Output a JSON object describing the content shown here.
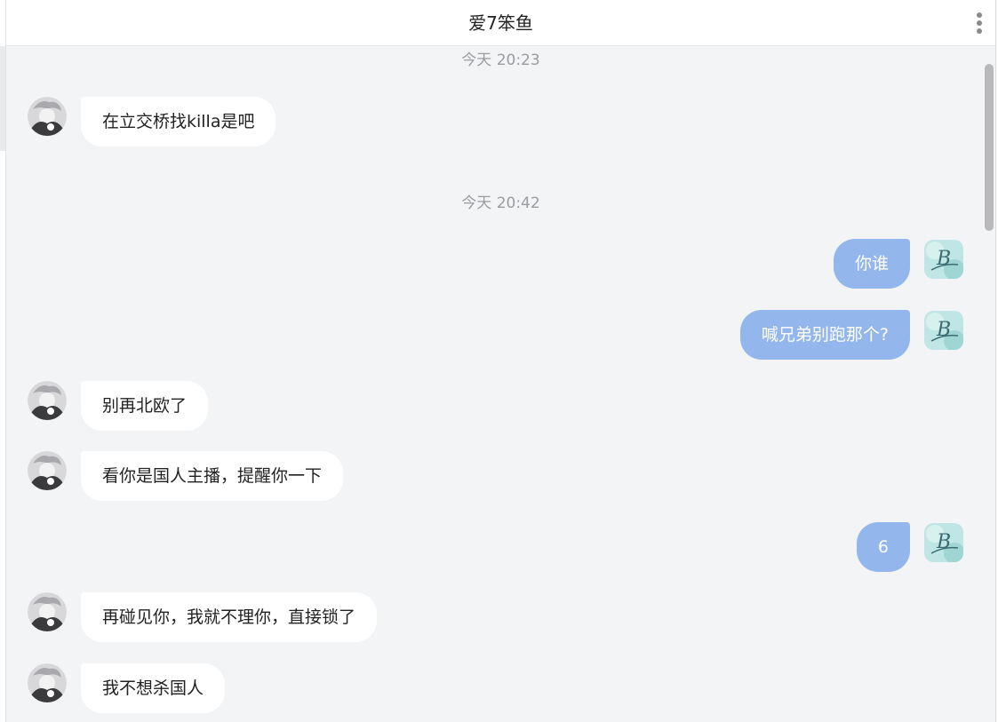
{
  "header": {
    "title": "爱7笨鱼"
  },
  "colors": {
    "outgoing_bubble": "#93b6ec",
    "incoming_bubble": "#ffffff",
    "background": "#f3f4f6"
  },
  "messages": {
    "ts1": "今天 20:23",
    "m1": "在立交桥找killa是吧",
    "ts2": "今天 20:42",
    "m2": "你谁",
    "m3": "喊兄弟别跑那个?",
    "m4": "别再北欧了",
    "m5": "看你是国人主播，提醒你一下",
    "m6": "6",
    "m7": "再碰见你，我就不理你，直接锁了",
    "m8": "我不想杀国人"
  },
  "avatars": {
    "contact_glyph": "",
    "self_glyph": "B"
  }
}
